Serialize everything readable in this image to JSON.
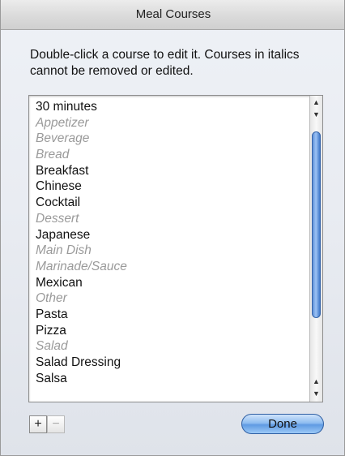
{
  "window": {
    "title": "Meal Courses"
  },
  "instructions": "Double-click a course to edit it. Courses in italics cannot be removed or edited.",
  "courses": [
    {
      "label": "30 minutes",
      "builtin": false
    },
    {
      "label": "Appetizer",
      "builtin": true
    },
    {
      "label": "Beverage",
      "builtin": true
    },
    {
      "label": "Bread",
      "builtin": true
    },
    {
      "label": "Breakfast",
      "builtin": false
    },
    {
      "label": "Chinese",
      "builtin": false
    },
    {
      "label": "Cocktail",
      "builtin": false
    },
    {
      "label": "Dessert",
      "builtin": true
    },
    {
      "label": "Japanese",
      "builtin": false
    },
    {
      "label": "Main Dish",
      "builtin": true
    },
    {
      "label": "Marinade/Sauce",
      "builtin": true
    },
    {
      "label": "Mexican",
      "builtin": false
    },
    {
      "label": "Other",
      "builtin": true
    },
    {
      "label": "Pasta",
      "builtin": false
    },
    {
      "label": "Pizza",
      "builtin": false
    },
    {
      "label": "Salad",
      "builtin": true
    },
    {
      "label": "Salad Dressing",
      "builtin": false
    },
    {
      "label": "Salsa",
      "builtin": false
    }
  ],
  "buttons": {
    "add": "+",
    "remove": "−",
    "done": "Done"
  },
  "icons": {
    "scroll_up": "▲",
    "scroll_down": "▼"
  },
  "colors": {
    "builtin_text": "#9a9a9a",
    "accent": "#5f9ae3"
  }
}
